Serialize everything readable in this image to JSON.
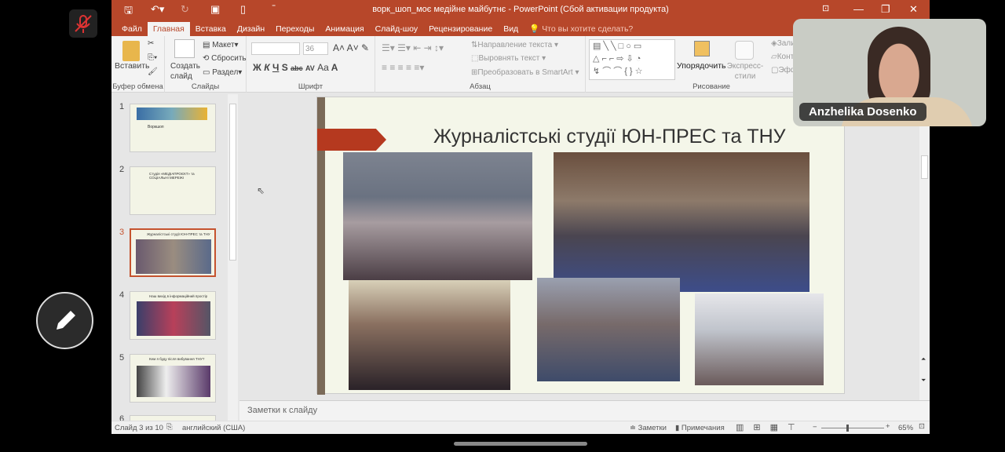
{
  "window": {
    "title": "ворк_шоп_моє медійне майбутнє - PowerPoint (Сбой активации продукта)"
  },
  "tabs": [
    "Файл",
    "Главная",
    "Вставка",
    "Дизайн",
    "Переходы",
    "Анимация",
    "Слайд-шоу",
    "Рецензирование",
    "Вид"
  ],
  "tell_me": "Что вы хотите сделать?",
  "ribbon": {
    "clipboard": {
      "paste": "Вставить",
      "label": "Буфер обмена"
    },
    "slides": {
      "new_slide": "Создать слайд",
      "layout": "Макет",
      "reset": "Сбросить",
      "section": "Раздел",
      "label": "Слайды"
    },
    "font": {
      "size": "36",
      "label": "Шрифт",
      "styles": [
        "Ж",
        "К",
        "Ч",
        "S",
        "abc",
        "AV",
        "Aa",
        "A"
      ]
    },
    "paragraph": {
      "text_direction": "Направление текста",
      "align_text": "Выровнять текст",
      "smartart": "Преобразовать в SmartArt",
      "label": "Абзац"
    },
    "drawing": {
      "arrange": "Упорядочить",
      "quick_styles": "Экспресс-стили",
      "fill": "Залив",
      "outline": "Конту",
      "effects": "Эффе",
      "label": "Рисование"
    }
  },
  "thumbnails": [
    {
      "num": "1",
      "title": "Воркшоп"
    },
    {
      "num": "2",
      "title": "Студія «МЕДІАПРОЄКТ» та СОЦІАЛЬНІ МЕРЕЖІ"
    },
    {
      "num": "3",
      "title": "Журналістські студії ЮН-ПРЕС та ТНУ"
    },
    {
      "num": "4",
      "title": "Наш вихід в інформаційний простір"
    },
    {
      "num": "5",
      "title": "Кем я буду після вибування ТНУ?"
    },
    {
      "num": "6",
      "title": ""
    }
  ],
  "slide": {
    "title": "Журналістські студії ЮН-ПРЕС та ТНУ"
  },
  "notes_placeholder": "Заметки к слайду",
  "status": {
    "slide_info": "Слайд 3 из 10",
    "language": "английский (США)",
    "notes": "Заметки",
    "comments": "Примечания",
    "zoom": "65%",
    "zoom_fraction": 0.4
  },
  "video": {
    "name": "Anzhelika Dosenko"
  },
  "colors": {
    "accent": "#b7472a"
  }
}
